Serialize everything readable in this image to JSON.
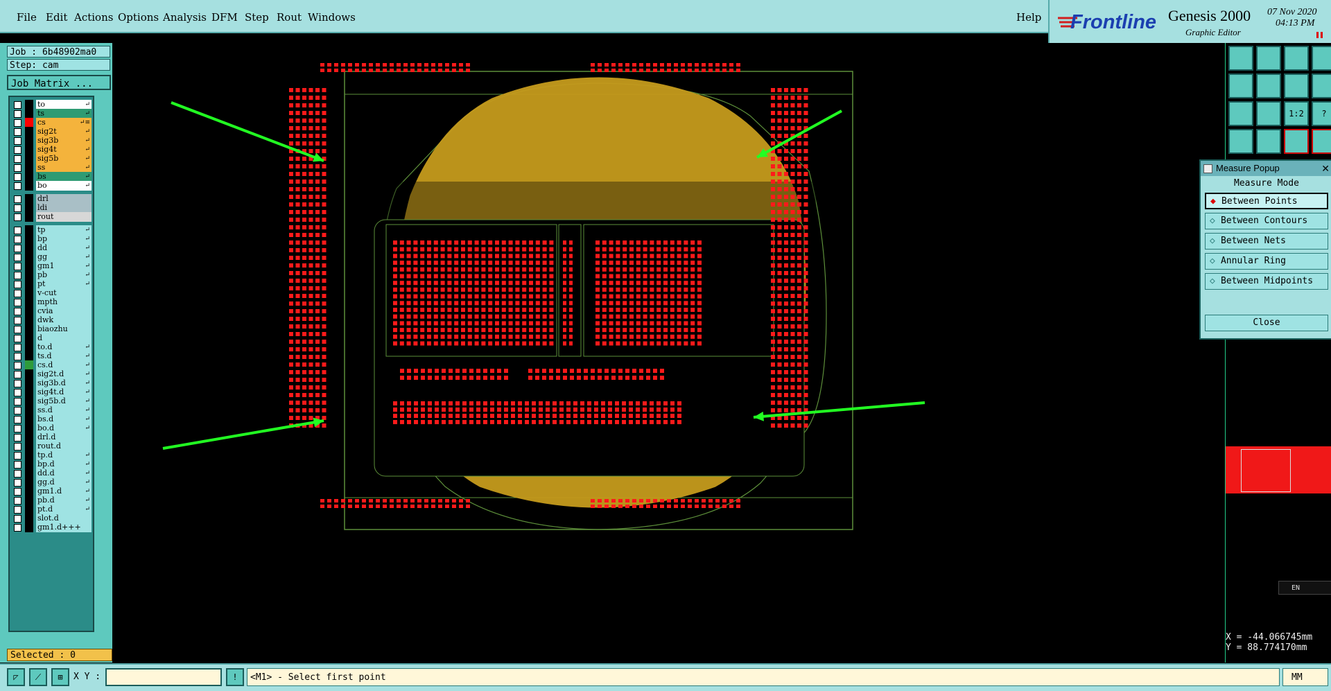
{
  "menu": [
    "File",
    "Edit",
    "Actions",
    "Options",
    "Analysis",
    "DFM",
    "Step",
    "Rout",
    "Windows"
  ],
  "help_label": "Help",
  "brand": {
    "logo": "Frontline",
    "product": "Genesis 2000",
    "subtitle": "Graphic Editor",
    "date": "07 Nov 2020",
    "time": "04:13 PM"
  },
  "job": {
    "job_line": "Job : 6b48902ma0",
    "step_line": "Step: cam",
    "matrix_button": "Job Matrix ..."
  },
  "layers_group1": [
    {
      "name": "to",
      "color": "#ffffff",
      "box": "#000000",
      "flag": "↵"
    },
    {
      "name": "ts",
      "color": "#2e9b73",
      "box": "#000000",
      "flag": "↵"
    },
    {
      "name": "cs",
      "color": "#f4b33c",
      "box": "#ff0000",
      "flag": "↵≡"
    },
    {
      "name": "sig2t",
      "color": "#f4b33c",
      "box": "#000000",
      "flag": "↵"
    },
    {
      "name": "sig3b",
      "color": "#f4b33c",
      "box": "#000000",
      "flag": "↵"
    },
    {
      "name": "sig4t",
      "color": "#f4b33c",
      "box": "#000000",
      "flag": "↵"
    },
    {
      "name": "sig5b",
      "color": "#f4b33c",
      "box": "#000000",
      "flag": "↵"
    },
    {
      "name": "ss",
      "color": "#f4b33c",
      "box": "#000000",
      "flag": "↵"
    },
    {
      "name": "bs",
      "color": "#2e9b73",
      "box": "#000000",
      "flag": "↵"
    },
    {
      "name": "bo",
      "color": "#ffffff",
      "box": "#000000",
      "flag": "↵"
    }
  ],
  "layers_group2": [
    {
      "name": "drl",
      "color": "#a9bfc6",
      "box": "#000000",
      "flag": ""
    },
    {
      "name": "ldi",
      "color": "#a9bfc6",
      "box": "#000000",
      "flag": ""
    },
    {
      "name": "rout",
      "color": "#d7d7d7",
      "box": "#000000",
      "flag": ""
    }
  ],
  "layers_group3": [
    {
      "name": "tp",
      "color": "#9fe3e3",
      "box": "#000000",
      "flag": "↵"
    },
    {
      "name": "bp",
      "color": "#9fe3e3",
      "box": "#000000",
      "flag": "↵"
    },
    {
      "name": "dd",
      "color": "#9fe3e3",
      "box": "#000000",
      "flag": "↵"
    },
    {
      "name": "gg",
      "color": "#9fe3e3",
      "box": "#000000",
      "flag": "↵"
    },
    {
      "name": "gm1",
      "color": "#9fe3e3",
      "box": "#000000",
      "flag": "↵"
    },
    {
      "name": "pb",
      "color": "#9fe3e3",
      "box": "#000000",
      "flag": "↵"
    },
    {
      "name": "pt",
      "color": "#9fe3e3",
      "box": "#000000",
      "flag": "↵"
    },
    {
      "name": "v-cut",
      "color": "#9fe3e3",
      "box": "#000000",
      "flag": ""
    },
    {
      "name": "mpth",
      "color": "#9fe3e3",
      "box": "#000000",
      "flag": ""
    },
    {
      "name": "cvia",
      "color": "#9fe3e3",
      "box": "#000000",
      "flag": ""
    },
    {
      "name": "dwk",
      "color": "#9fe3e3",
      "box": "#000000",
      "flag": ""
    },
    {
      "name": "biaozhu",
      "color": "#9fe3e3",
      "box": "#000000",
      "flag": ""
    },
    {
      "name": "d",
      "color": "#9fe3e3",
      "box": "#000000",
      "flag": ""
    },
    {
      "name": "to.d",
      "color": "#9fe3e3",
      "box": "#000000",
      "flag": "↵"
    },
    {
      "name": "ts.d",
      "color": "#9fe3e3",
      "box": "#000000",
      "flag": "↵"
    },
    {
      "name": "cs.d",
      "color": "#9fe3e3",
      "box": "#2e9b3b",
      "flag": "↵"
    },
    {
      "name": "sig2t.d",
      "color": "#9fe3e3",
      "box": "#000000",
      "flag": "↵"
    },
    {
      "name": "sig3b.d",
      "color": "#9fe3e3",
      "box": "#000000",
      "flag": "↵"
    },
    {
      "name": "sig4t.d",
      "color": "#9fe3e3",
      "box": "#000000",
      "flag": "↵"
    },
    {
      "name": "sig5b.d",
      "color": "#9fe3e3",
      "box": "#000000",
      "flag": "↵"
    },
    {
      "name": "ss.d",
      "color": "#9fe3e3",
      "box": "#000000",
      "flag": "↵"
    },
    {
      "name": "bs.d",
      "color": "#9fe3e3",
      "box": "#000000",
      "flag": "↵"
    },
    {
      "name": "bo.d",
      "color": "#9fe3e3",
      "box": "#000000",
      "flag": "↵"
    },
    {
      "name": "drl.d",
      "color": "#9fe3e3",
      "box": "#000000",
      "flag": ""
    },
    {
      "name": "rout.d",
      "color": "#9fe3e3",
      "box": "#000000",
      "flag": ""
    },
    {
      "name": "tp.d",
      "color": "#9fe3e3",
      "box": "#000000",
      "flag": "↵"
    },
    {
      "name": "bp.d",
      "color": "#9fe3e3",
      "box": "#000000",
      "flag": "↵"
    },
    {
      "name": "dd.d",
      "color": "#9fe3e3",
      "box": "#000000",
      "flag": "↵"
    },
    {
      "name": "gg.d",
      "color": "#9fe3e3",
      "box": "#000000",
      "flag": "↵"
    },
    {
      "name": "gm1.d",
      "color": "#9fe3e3",
      "box": "#000000",
      "flag": "↵"
    },
    {
      "name": "pb.d",
      "color": "#9fe3e3",
      "box": "#000000",
      "flag": "↵"
    },
    {
      "name": "pt.d",
      "color": "#9fe3e3",
      "box": "#000000",
      "flag": "↵"
    },
    {
      "name": "slot.d",
      "color": "#9fe3e3",
      "box": "#000000",
      "flag": ""
    },
    {
      "name": "gm1.d+++",
      "color": "#9fe3e3",
      "box": "#000000",
      "flag": ""
    }
  ],
  "selected_label": "Selected : 0",
  "bottom": {
    "xy_label": "X Y :",
    "xy_value": "",
    "prompt": "<M1> - Select first point",
    "units": "MM"
  },
  "measure_popup": {
    "title": "Measure Popup",
    "mode_label": "Measure Mode",
    "options": [
      "Between Points",
      "Between Contours",
      "Between Nets",
      "Annular Ring",
      "Between Midpoints"
    ],
    "close_label": "Close"
  },
  "toolbar_labels": [
    "",
    "",
    "",
    "",
    "",
    "",
    "",
    "",
    "1:2",
    "?",
    "",
    "",
    "",
    "",
    ""
  ],
  "coords": {
    "x": "X = -44.066745mm",
    "y": "Y = 88.774170mm"
  },
  "lang_badge": "EN",
  "colors": {
    "copper": "#c69b1d",
    "pad_red": "#ff1a1a",
    "outline": "#5d8f3a",
    "arrow": "#22ff22"
  }
}
